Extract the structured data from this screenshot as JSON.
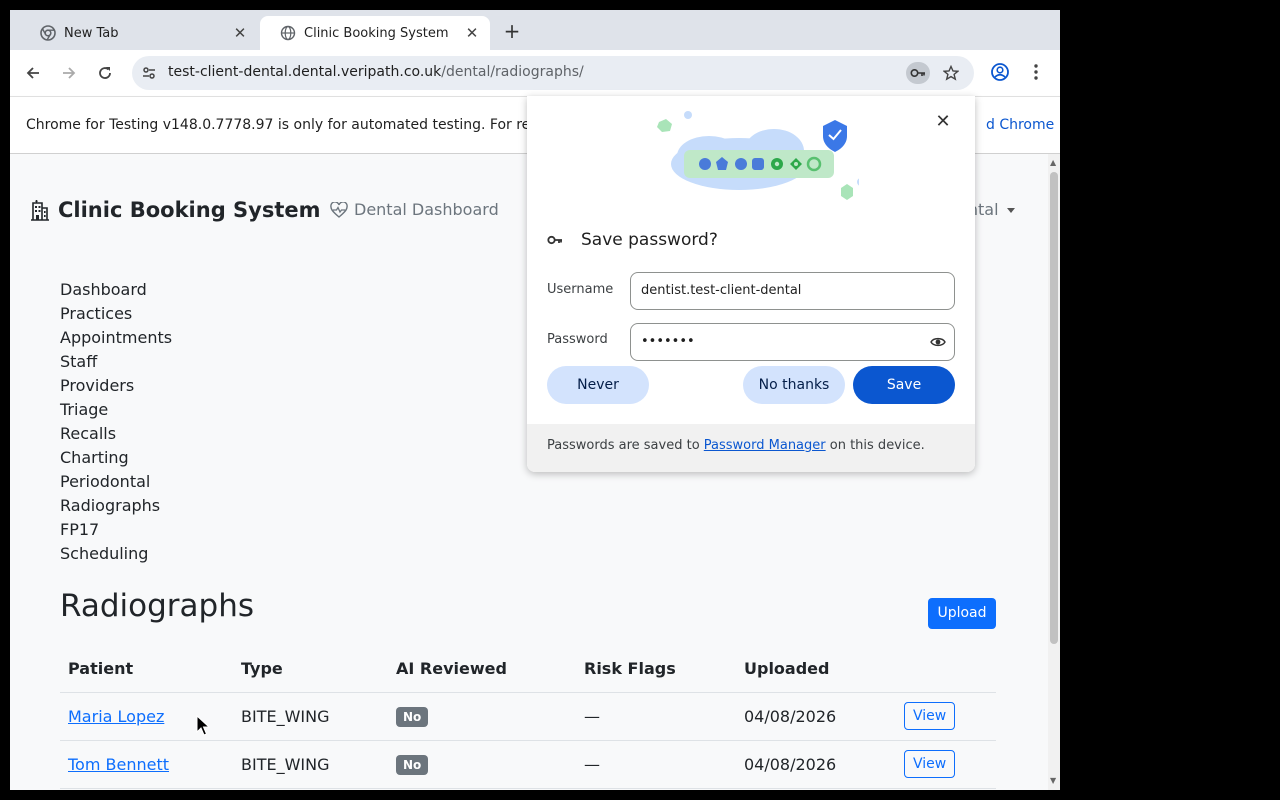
{
  "browser": {
    "tabs": [
      {
        "title": "New Tab",
        "active": false
      },
      {
        "title": "Clinic Booking System",
        "active": true
      }
    ],
    "url": {
      "host": "test-client-dental.dental.veripath.co.uk",
      "path": "/dental/radiographs/"
    },
    "infobar": {
      "text": "Chrome for Testing v148.0.7778.97 is only for automated testing. For re",
      "link": "d Chrome"
    }
  },
  "password_bubble": {
    "title": "Save password?",
    "username_label": "Username",
    "username_value": "dentist.test-client-dental",
    "password_label": "Password",
    "password_value": "•••••••",
    "never_label": "Never",
    "no_thanks_label": "No thanks",
    "save_label": "Save",
    "footer_prefix": "Passwords are saved to ",
    "footer_link": "Password Manager",
    "footer_suffix": " on this device."
  },
  "app": {
    "brand": "Clinic Booking System",
    "dashboard_link": "Dental Dashboard",
    "user_menu": "ental",
    "nav": [
      "Dashboard",
      "Practices",
      "Appointments",
      "Staff",
      "Providers",
      "Triage",
      "Recalls",
      "Charting",
      "Periodontal",
      "Radiographs",
      "FP17",
      "Scheduling"
    ],
    "page_title": "Radiographs",
    "upload_label": "Upload",
    "table": {
      "headers": [
        "Patient",
        "Type",
        "AI Reviewed",
        "Risk Flags",
        "Uploaded",
        ""
      ],
      "rows": [
        {
          "patient": "Maria Lopez",
          "type": "BITE_WING",
          "ai_reviewed": "No",
          "risk_flags": "—",
          "uploaded": "04/08/2026",
          "action": "View"
        },
        {
          "patient": "Tom Bennett",
          "type": "BITE_WING",
          "ai_reviewed": "No",
          "risk_flags": "—",
          "uploaded": "04/08/2026",
          "action": "View"
        }
      ]
    }
  },
  "colors": {
    "primary": "#0d6efd",
    "chrome_blue": "#0b57d0",
    "badge_gray": "#6c757d"
  }
}
